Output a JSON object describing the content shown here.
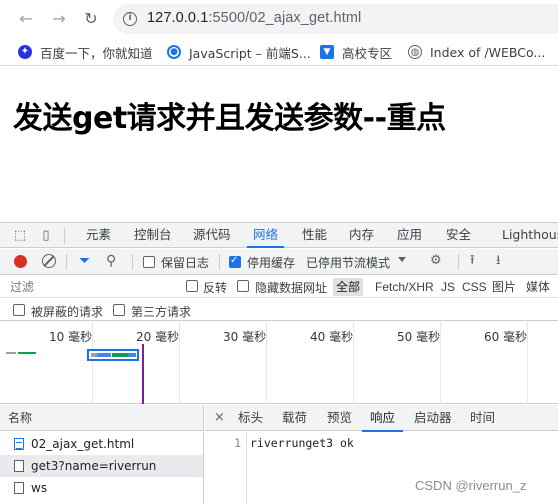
{
  "browser": {
    "back_icon": "←",
    "forward_icon": "→",
    "reload_icon": "↻",
    "url_host": "127.0.0.1",
    "url_rest": ":5500/02_ajax_get.html"
  },
  "bookmarks": [
    {
      "label": "百度一下，你就知道",
      "icon": "baidu-icon"
    },
    {
      "label": "JavaScript – 前端S...",
      "icon": "site-icon"
    },
    {
      "label": "高校专区",
      "icon": "school-icon"
    },
    {
      "label": "Index of /WEBCo...",
      "icon": "globe-icon"
    }
  ],
  "page": {
    "heading": "发送get请求并且发送参数--重点"
  },
  "devtools": {
    "tabs": [
      "元素",
      "控制台",
      "源代码",
      "网络",
      "性能",
      "内存",
      "应用",
      "安全",
      "Lighthouse"
    ],
    "active_tab": "网络",
    "toolbar": {
      "preserve_log": "保留日志",
      "preserve_log_checked": false,
      "disable_cache": "停用缓存",
      "disable_cache_checked": true,
      "throttling": "已停用节流模式"
    },
    "filter": {
      "placeholder": "过滤",
      "invert": "反转",
      "hide_data_urls": "隐藏数据网址",
      "types": [
        "全部",
        "Fetch/XHR",
        "JS",
        "CSS",
        "图片",
        "媒体"
      ],
      "active_type": "全部",
      "blocked_requests": "被屏蔽的请求",
      "third_party": "第三方请求"
    },
    "timeline": {
      "ticks": [
        "10 毫秒",
        "20 毫秒",
        "30 毫秒",
        "40 毫秒",
        "50 毫秒",
        "60 毫秒"
      ]
    },
    "requests": {
      "header": "名称",
      "rows": [
        {
          "name": "02_ajax_get.html",
          "type": "document",
          "selected": false
        },
        {
          "name": "get3?name=riverrun",
          "type": "xhr",
          "selected": true
        },
        {
          "name": "ws",
          "type": "websocket",
          "selected": false
        }
      ]
    },
    "detail": {
      "close_icon": "×",
      "tabs": [
        "标头",
        "载荷",
        "预览",
        "响应",
        "启动器",
        "时间"
      ],
      "active_tab": "响应",
      "response_lines": [
        {
          "num": "1",
          "text": "riverrunget3 ok"
        }
      ]
    },
    "colors": {
      "accent": "#1a73e8",
      "record": "#d93025",
      "dom_content_loaded": "#7b1fa2"
    }
  },
  "watermark": "CSDN @riverrun_z"
}
